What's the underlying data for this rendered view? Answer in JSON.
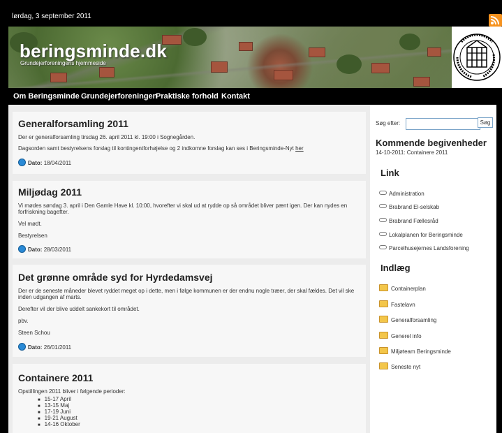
{
  "topbar": {
    "date": "lørdag, 3 september 2011",
    "rss_icon": "rss-icon"
  },
  "header": {
    "site_title": "beringsminde.dk",
    "site_subtitle": "Grundejerforeningens hjemmeside",
    "logo_text": "GRUNDEJERFORENINGEN BERINGSMINDE"
  },
  "nav": {
    "items": [
      "Om Beringsminde",
      "Grundejerforeningen",
      "Praktiske forhold",
      "Kontakt"
    ]
  },
  "posts": [
    {
      "title": "Generalforsamling 2011",
      "paragraphs": [
        "Der er generalforsamling tirsdag 26. april 2011 kl. 19:00 i Sognegården.",
        "Dagsorden samt bestyrelsens forslag til kontingentforhøjelse og 2 indkomne forslag kan ses i Beringsminde-Nyt"
      ],
      "link_text": "her",
      "date_label": "Dato:",
      "date": "18/04/2011"
    },
    {
      "title": "Miljødag 2011",
      "paragraphs": [
        "Vi mødes søndag 3. april i Den Gamle Have kl. 10:00, hvorefter vi skal ud at rydde op så området bliver pænt igen. Der kan nydes en forfriskning bagefter.",
        "Vel mødt.",
        "Bestyrelsen"
      ],
      "date_label": "Dato:",
      "date": "28/03/2011"
    },
    {
      "title": "Det grønne område syd for Hyrdedamsvej",
      "paragraphs": [
        "Der er de seneste måneder blevet ryddet meget op i dette, men i følge kommunen er der endnu nogle træer, der skal fældes. Det vil ske inden udgangen af marts.",
        "Derefter vil der blive uddelt sankekort til området.",
        "pbv.",
        "Steen Schou"
      ],
      "date_label": "Dato:",
      "date": "26/01/2011"
    },
    {
      "title": "Containere 2011",
      "paragraphs": [
        "Opstillingen 2011 bliver i følgende perioder:"
      ],
      "periods": [
        "15-17 April",
        "13-15 Maj",
        "17-19 Juni",
        "19-21 August",
        "14-16 Oktober"
      ]
    }
  ],
  "sidebar": {
    "search_label": "Søg efter:",
    "search_value": "",
    "search_button": "Søg",
    "events_title": "Kommende begivenheder",
    "events": [
      "14-10-2011: Containere 2011"
    ],
    "links_title": "Link",
    "links": [
      "Administration",
      "Brabrand El-selskab",
      "Brabrand Fællesråd",
      "Lokalplanen for Beringsminde",
      "Parcelhusejernes Landsforening"
    ],
    "categories_title": "Indlæg",
    "categories": [
      "Containerplan",
      "Fastelavn",
      "Generalforsamling",
      "Generel info",
      "Miljøteam Beringsminde",
      "Seneste nyt"
    ]
  },
  "colors": {
    "background": "#000000",
    "content_bg": "#ececec",
    "post_bg": "#f7f7f7",
    "accent": "#2a8ad6",
    "rss": "#f6921e"
  }
}
